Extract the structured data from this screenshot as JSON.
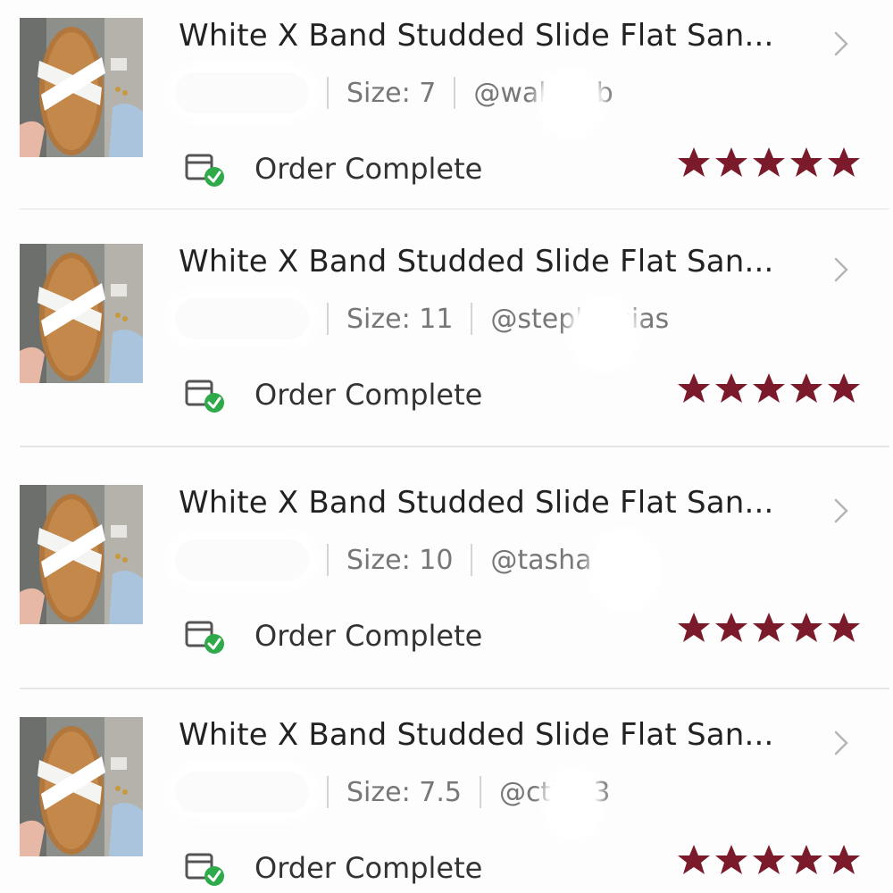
{
  "orders": [
    {
      "title": "White X Band Studded Slide Flat San...",
      "size_text": "Size: 7",
      "user_text": "@wak  abb",
      "status": "Order Complete",
      "rating": 5
    },
    {
      "title": "White X Band Studded Slide Flat San...",
      "size_text": "Size: 11",
      "user_text": "@steph  esias",
      "status": "Order Complete",
      "rating": 5
    },
    {
      "title": "White X Band Studded Slide Flat San...",
      "size_text": "Size: 10",
      "user_text": "@tasha  ann",
      "status": "Order Complete",
      "rating": 5
    },
    {
      "title": "White X Band Studded Slide Flat San...",
      "size_text": "Size: 7.5",
      "user_text": "@cti  /13",
      "status": "Order Complete",
      "rating": 5
    }
  ],
  "icons": {
    "row_chevron": "chevron-right-icon",
    "status_icon": "package-check-icon",
    "rating_star": "star-icon"
  },
  "colors": {
    "star": "#7b1a2a",
    "check": "#2eaa4a",
    "divider": "#e6e6e6",
    "title": "#222222",
    "meta": "#777777"
  }
}
